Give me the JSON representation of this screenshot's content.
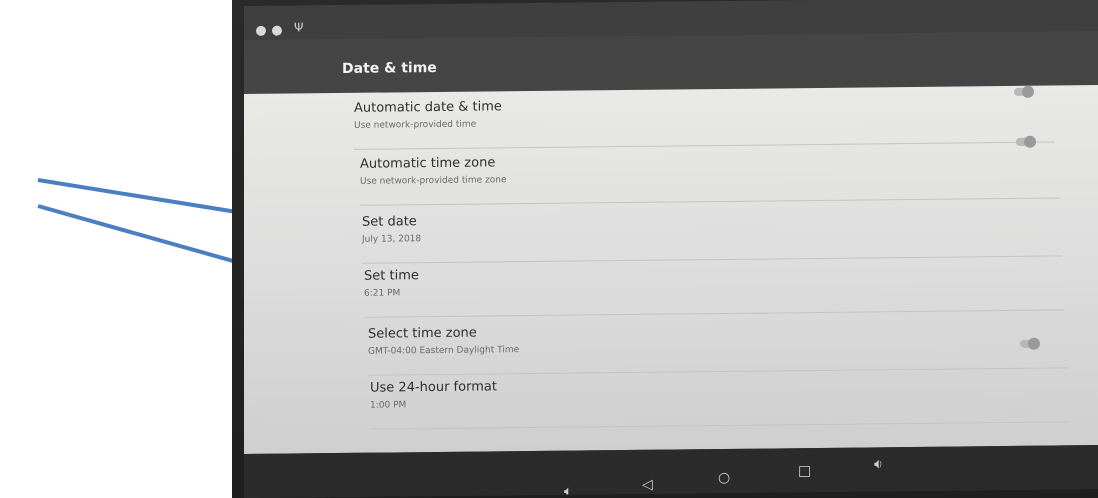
{
  "app_bar": {
    "title": "Date & time"
  },
  "settings": [
    {
      "title": "Automatic date & time",
      "subtitle": "Use network-provided time",
      "toggle": true
    },
    {
      "title": "Automatic time zone",
      "subtitle": "Use network-provided time zone",
      "toggle": true
    },
    {
      "title": "Set date",
      "subtitle": "July 13, 2018",
      "toggle": false
    },
    {
      "title": "Set time",
      "subtitle": "6:21 PM",
      "toggle": false
    },
    {
      "title": "Select time zone",
      "subtitle": "GMT-04:00 Eastern Daylight Time",
      "toggle": false
    },
    {
      "title": "Use 24-hour format",
      "subtitle": "1:00 PM",
      "toggle": true
    }
  ],
  "icons": {
    "status": [
      "status-dot-icon",
      "status-dot-icon",
      "usb-icon"
    ],
    "nav": [
      "volume-down-icon",
      "back-icon",
      "home-icon",
      "recents-icon",
      "volume-up-icon"
    ]
  },
  "colors": {
    "arrow": "#4a7fc1",
    "app_bar": "#454545",
    "list_bg": "#e3e3e3"
  }
}
